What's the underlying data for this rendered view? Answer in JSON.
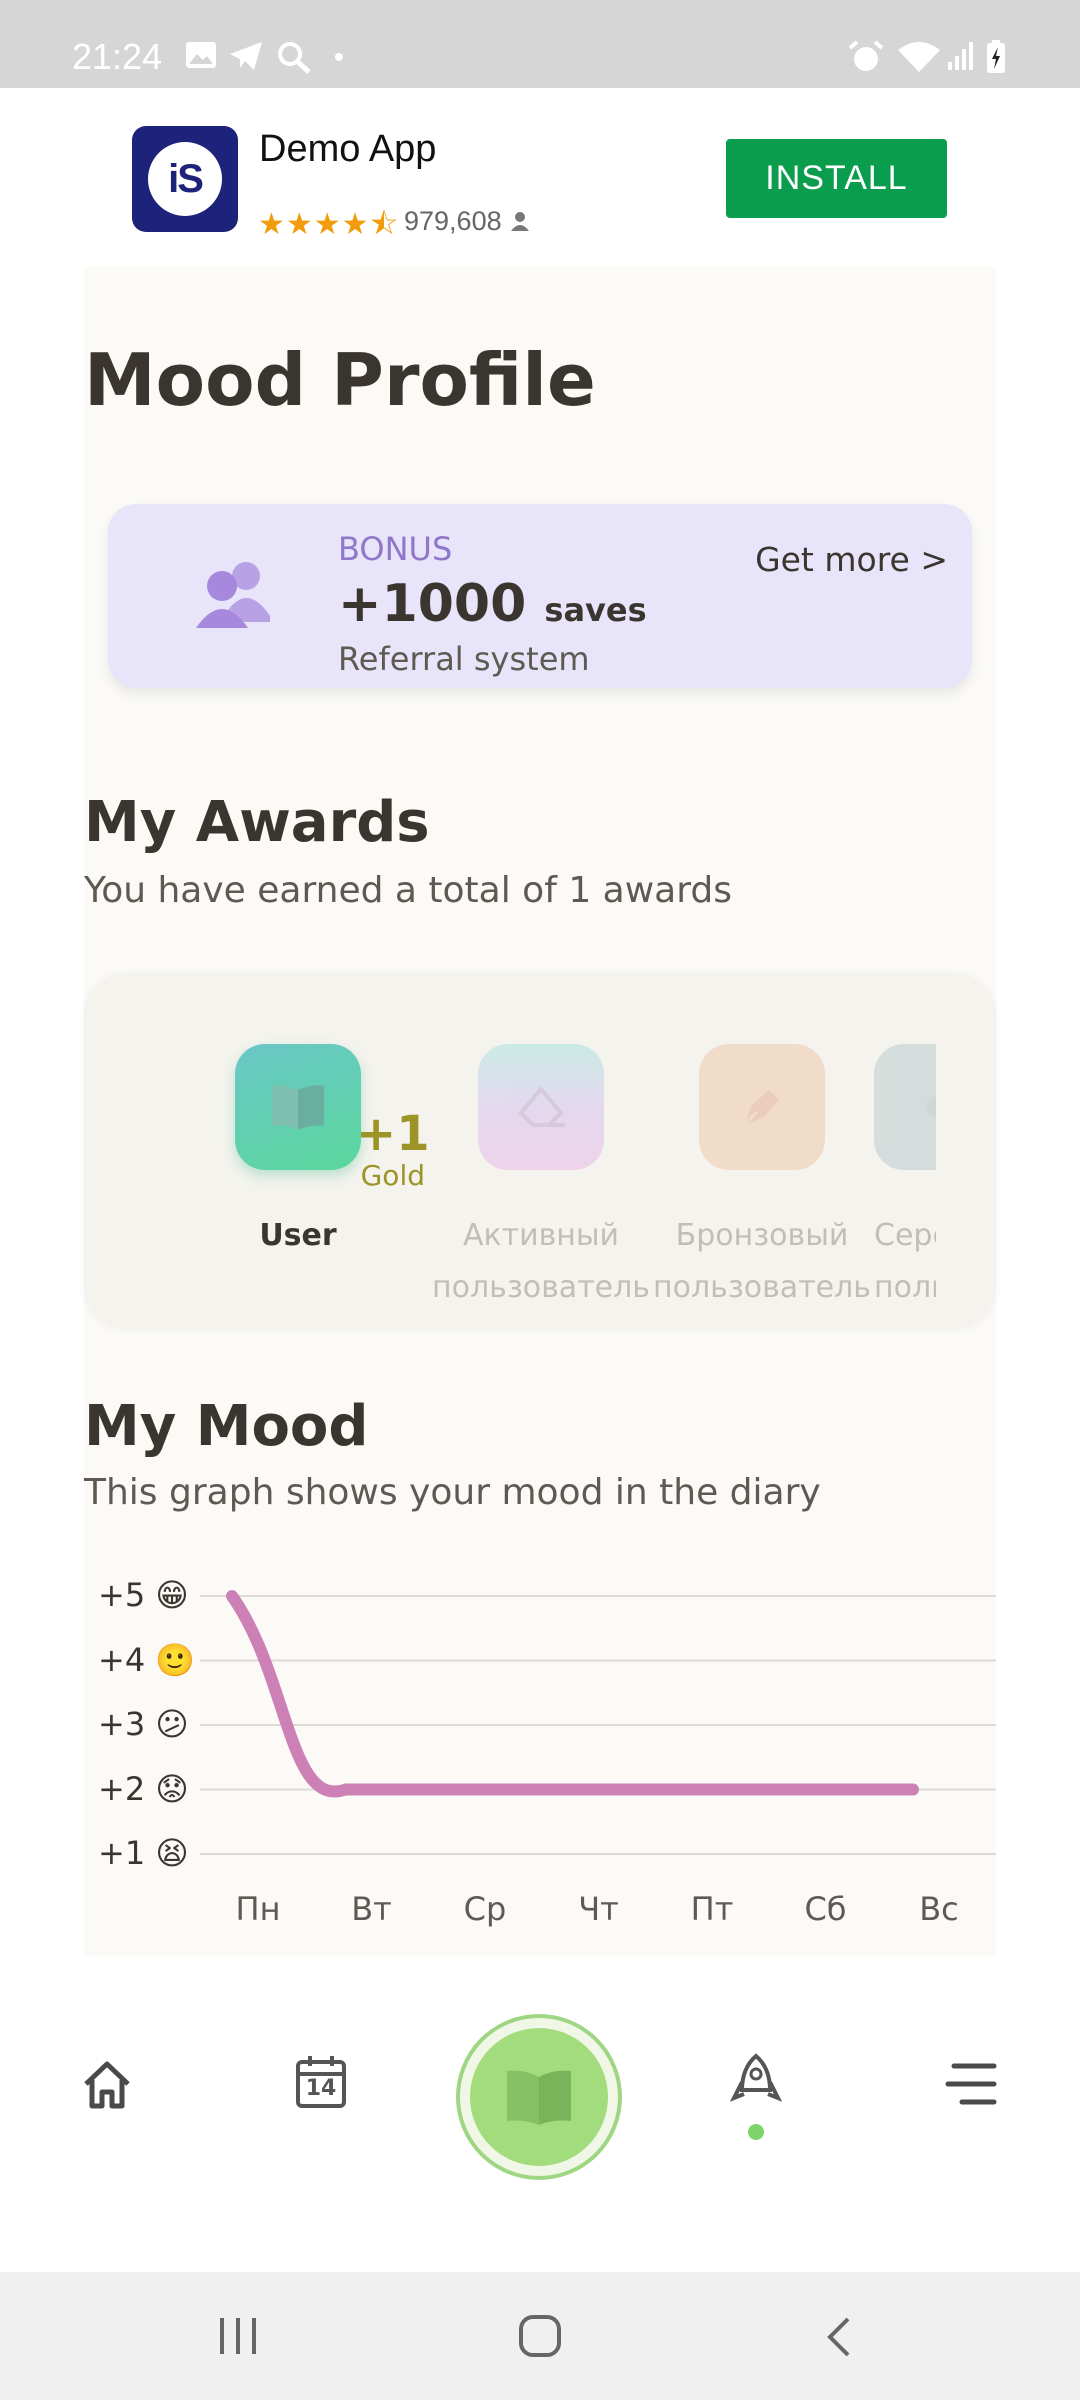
{
  "status_bar": {
    "time": "21:24"
  },
  "ad": {
    "logo_text": "iS",
    "app_name": "Demo App",
    "stars": "★★★★⯪",
    "rating_count": "979,608",
    "install_label": "INSTALL"
  },
  "page": {
    "title": "Mood Profile"
  },
  "bonus": {
    "kicker": "BONUS",
    "amount": "+1000",
    "unit": "saves",
    "subtitle": "Referral system",
    "action": "Get more >"
  },
  "awards": {
    "title": "My Awards",
    "subtitle": "You have earned a total of 1 awards",
    "items": [
      {
        "name": "User",
        "earned_count": "+1",
        "earned_tier": "Gold",
        "icon": "book-icon",
        "color": "#5fd5a6"
      },
      {
        "name_line1": "Активный",
        "name_line2": "пользователь",
        "icon": "eraser-icon",
        "color": "#d8c4f1"
      },
      {
        "name_line1": "Бронзовый",
        "name_line2": "пользователь",
        "icon": "pen-icon",
        "color": "#f3d3bd"
      },
      {
        "name_line1": "Сере",
        "name_line2": "поль",
        "icon": "award-icon",
        "color": "#cfd9db"
      }
    ]
  },
  "mood": {
    "title": "My Mood",
    "subtitle": "This graph shows your mood in the diary"
  },
  "chart_data": {
    "type": "line",
    "title": "",
    "xlabel": "",
    "ylabel": "",
    "categories": [
      "Пн",
      "Вт",
      "Ср",
      "Чт",
      "Пт",
      "Сб",
      "Вс"
    ],
    "y_ticks": [
      "+5",
      "+4",
      "+3",
      "+2",
      "+1"
    ],
    "y_emojis": [
      "😁",
      "🙂",
      "😕",
      "😟",
      "😫"
    ],
    "values": [
      5,
      2,
      2,
      2,
      2,
      2,
      2
    ],
    "ylim": [
      1,
      5
    ],
    "grid": true,
    "line_color": "#cc80b5"
  },
  "bottom_nav": {
    "items": [
      "home-icon",
      "calendar-icon",
      "diary-book-icon",
      "rocket-icon",
      "menu-icon"
    ],
    "calendar_day": "14",
    "accent": "#a3dc7c"
  }
}
